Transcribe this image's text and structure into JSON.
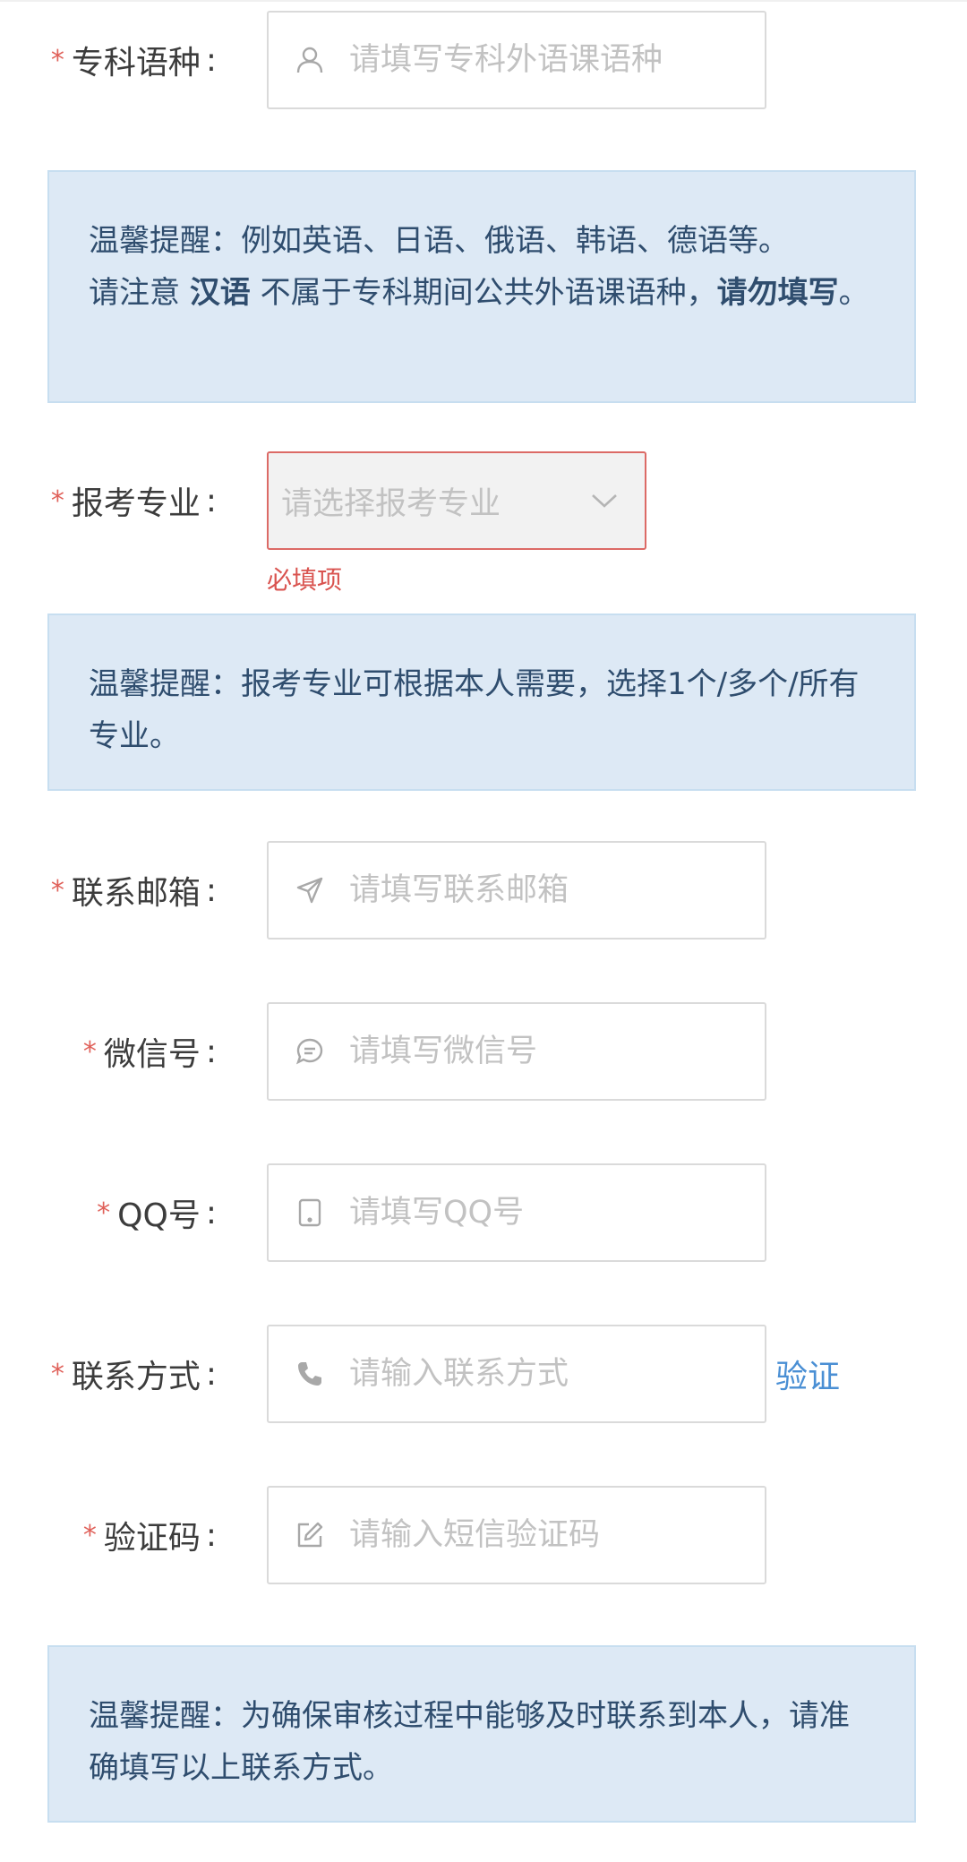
{
  "required_mark": "*",
  "colon": ":",
  "fields": {
    "language": {
      "label": "专科语种",
      "placeholder": "请填写专科外语课语种",
      "icon": "user-icon"
    },
    "major": {
      "label": "报考专业",
      "placeholder": "请选择报考专业",
      "error": "必填项",
      "icon": "chevron-down-icon"
    },
    "email": {
      "label": "联系邮箱",
      "placeholder": "请填写联系邮箱",
      "icon": "send-icon"
    },
    "wechat": {
      "label": "微信号",
      "placeholder": "请填写微信号",
      "icon": "chat-icon"
    },
    "qq": {
      "label": "QQ号",
      "placeholder": "请填写QQ号",
      "icon": "phone-device-icon"
    },
    "phone": {
      "label": "联系方式",
      "placeholder": "请输入联系方式",
      "icon": "phone-icon",
      "verify_label": "验证"
    },
    "code": {
      "label": "验证码",
      "placeholder": "请输入短信验证码",
      "icon": "edit-icon"
    }
  },
  "tips": {
    "language": {
      "line1": "温馨提醒：例如英语、日语、俄语、韩语、德语等。",
      "pre": "请注意 ",
      "bold1": "汉语",
      "mid": " 不属于专科期间公共外语课语种，",
      "bold2": "请勿填写",
      "post": "。"
    },
    "major": {
      "text": "温馨提醒：报考专业可根据本人需要，选择1个/多个/所有专业。"
    },
    "contact": {
      "text": "温馨提醒：为确保审核过程中能够及时联系到本人，请准确填写以上联系方式。"
    }
  },
  "colors": {
    "required": "#e0615a",
    "error": "#d9534f",
    "link": "#4a8fd4",
    "tip_bg": "#dde9f5",
    "tip_text": "#2f4d6e"
  }
}
